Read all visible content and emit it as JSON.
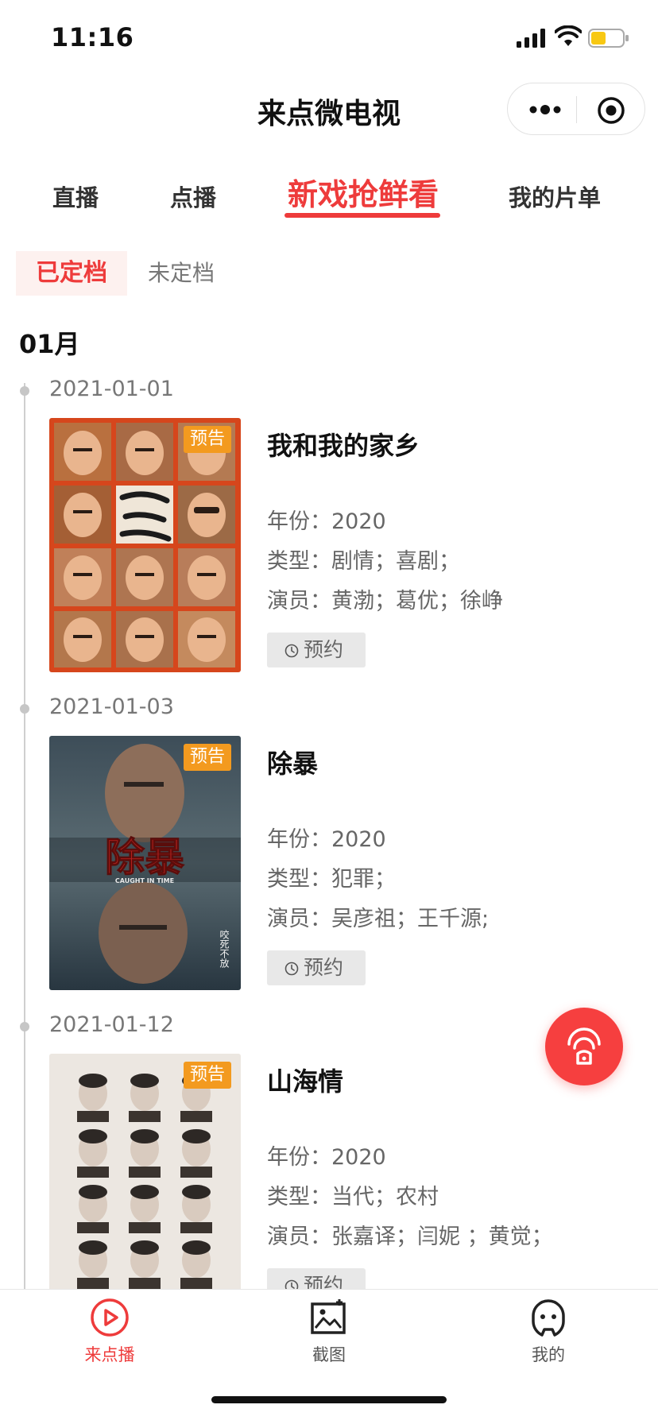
{
  "status_bar": {
    "time": "11:16",
    "battery_color": "#f8c813"
  },
  "app": {
    "title": "来点微电视"
  },
  "main_tabs": [
    {
      "label": "直播",
      "active": false
    },
    {
      "label": "点播",
      "active": false
    },
    {
      "label": "新戏抢鲜看",
      "active": true
    },
    {
      "label": "我的片单",
      "active": false
    }
  ],
  "sub_tabs": [
    {
      "label": "已定档",
      "active": true
    },
    {
      "label": "未定档",
      "active": false
    }
  ],
  "month": "01月",
  "movies": [
    {
      "date": "2021-01-01",
      "tag": "预告",
      "title": "我和我的家乡",
      "year_label": "年份：",
      "year": "2020",
      "genre_label": "类型：",
      "genre": "剧情；喜剧；",
      "cast_label": "演员：",
      "cast": "黄渤；葛优；徐峥",
      "reserve": "预约"
    },
    {
      "date": "2021-01-03",
      "tag": "预告",
      "title": "除暴",
      "year_label": "年份：",
      "year": "2020",
      "genre_label": "类型：",
      "genre": "犯罪；",
      "cast_label": "演员：",
      "cast": "吴彦祖；王千源;",
      "reserve": "预约",
      "poster_title": "除暴",
      "poster_subtitle": "CAUGHT IN TIME",
      "poster_slogan": "咬死不放"
    },
    {
      "date": "2021-01-12",
      "tag": "预告",
      "title": "山海情",
      "year_label": "年份：",
      "year": "2020",
      "genre_label": "类型：",
      "genre": "当代；农村",
      "cast_label": "演员：",
      "cast": "张嘉译；闫妮 ；黄觉；",
      "reserve": "预约"
    }
  ],
  "bottom_nav": [
    {
      "label": "来点播",
      "icon": "play-circle-icon",
      "active": true
    },
    {
      "label": "截图",
      "icon": "image-icon",
      "active": false
    },
    {
      "label": "我的",
      "icon": "profile-icon",
      "active": false
    }
  ],
  "colors": {
    "accent": "#ee3b3b",
    "tag": "#f39a1f",
    "float_button": "#f63f3f"
  }
}
